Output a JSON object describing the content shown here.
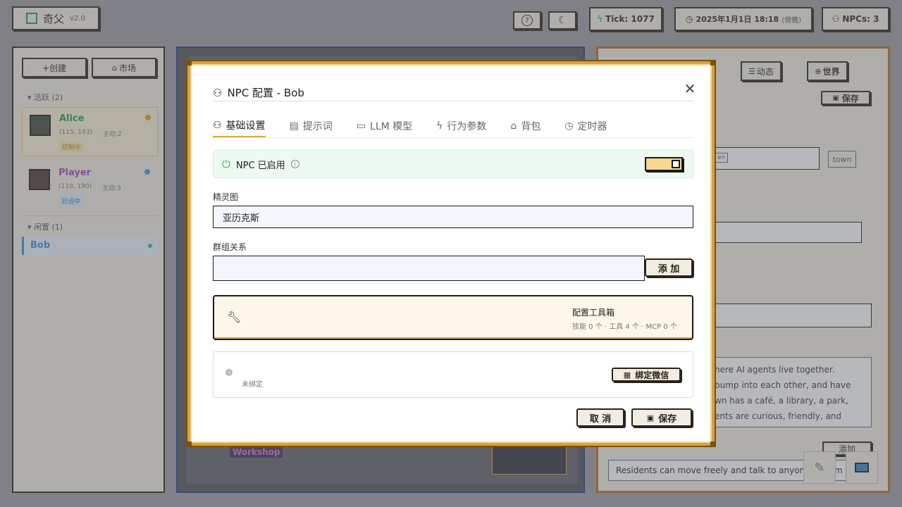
{
  "app": {
    "name": "奇父",
    "version": "v2.0"
  },
  "header": {
    "help_icon": "question-icon",
    "theme_icon": "moon-icon",
    "tick_label": "Tick:  1077",
    "datetime": "2025年1月1日 18:18",
    "period": "(傍晚)",
    "npcs": "NPCs: 3"
  },
  "sidebar": {
    "create": "+创建",
    "market": "市场",
    "active_group": "▾ 活跃 (2)",
    "idle_group": "▾ 闲置 (1)",
    "npcs": [
      {
        "name": "Alice",
        "pos": "(115, 183)",
        "initiative": "主动:2",
        "status": "控制中",
        "dot": "#e8a100",
        "color": "#1e9e3a"
      },
      {
        "name": "Player",
        "pos": "(110, 190)",
        "initiative": "主动:3",
        "status": "对话中",
        "dot": "#2a9ff0",
        "color": "#a042c8"
      },
      {
        "name": "Bob",
        "dot": "#2fbf5a",
        "color": "#3a8de0"
      }
    ]
  },
  "map": {
    "workshop_label": "Workshop"
  },
  "right_panel": {
    "dynamic": "动态",
    "world": "世界",
    "save": "保存",
    "tag_town": "town",
    "tag_partial": "en",
    "description_text": "here AI agents live together. bump into each other, and have wn has a café, a library, a park, ents are curious, friendly, and",
    "rules_add": "添加",
    "rule_1": "Residents can move freely and talk to anyone they m"
  },
  "modal": {
    "title": "NPC 配置 - Bob",
    "tabs": [
      "基础设置",
      "提示词",
      "LLM 模型",
      "行为参数",
      "背包",
      "定时器"
    ],
    "enabled_label": "NPC 已启用",
    "sprite_label": "精灵图",
    "sprite_value": "亚历克斯",
    "group_label": "群组关系",
    "group_add": "添 加",
    "toolbox_title": "配置工具箱",
    "toolbox_sub": "技能 0 个 · 工具 4 个 · MCP 0 个",
    "wechat_status": "未绑定",
    "wechat_bind": "绑定微信",
    "cancel": "取 消",
    "save": "保存"
  },
  "colors": {
    "accent": "#e1a73c",
    "enabled_bg": "#eefaf1",
    "enabled_icon": "#2fbf5a"
  }
}
